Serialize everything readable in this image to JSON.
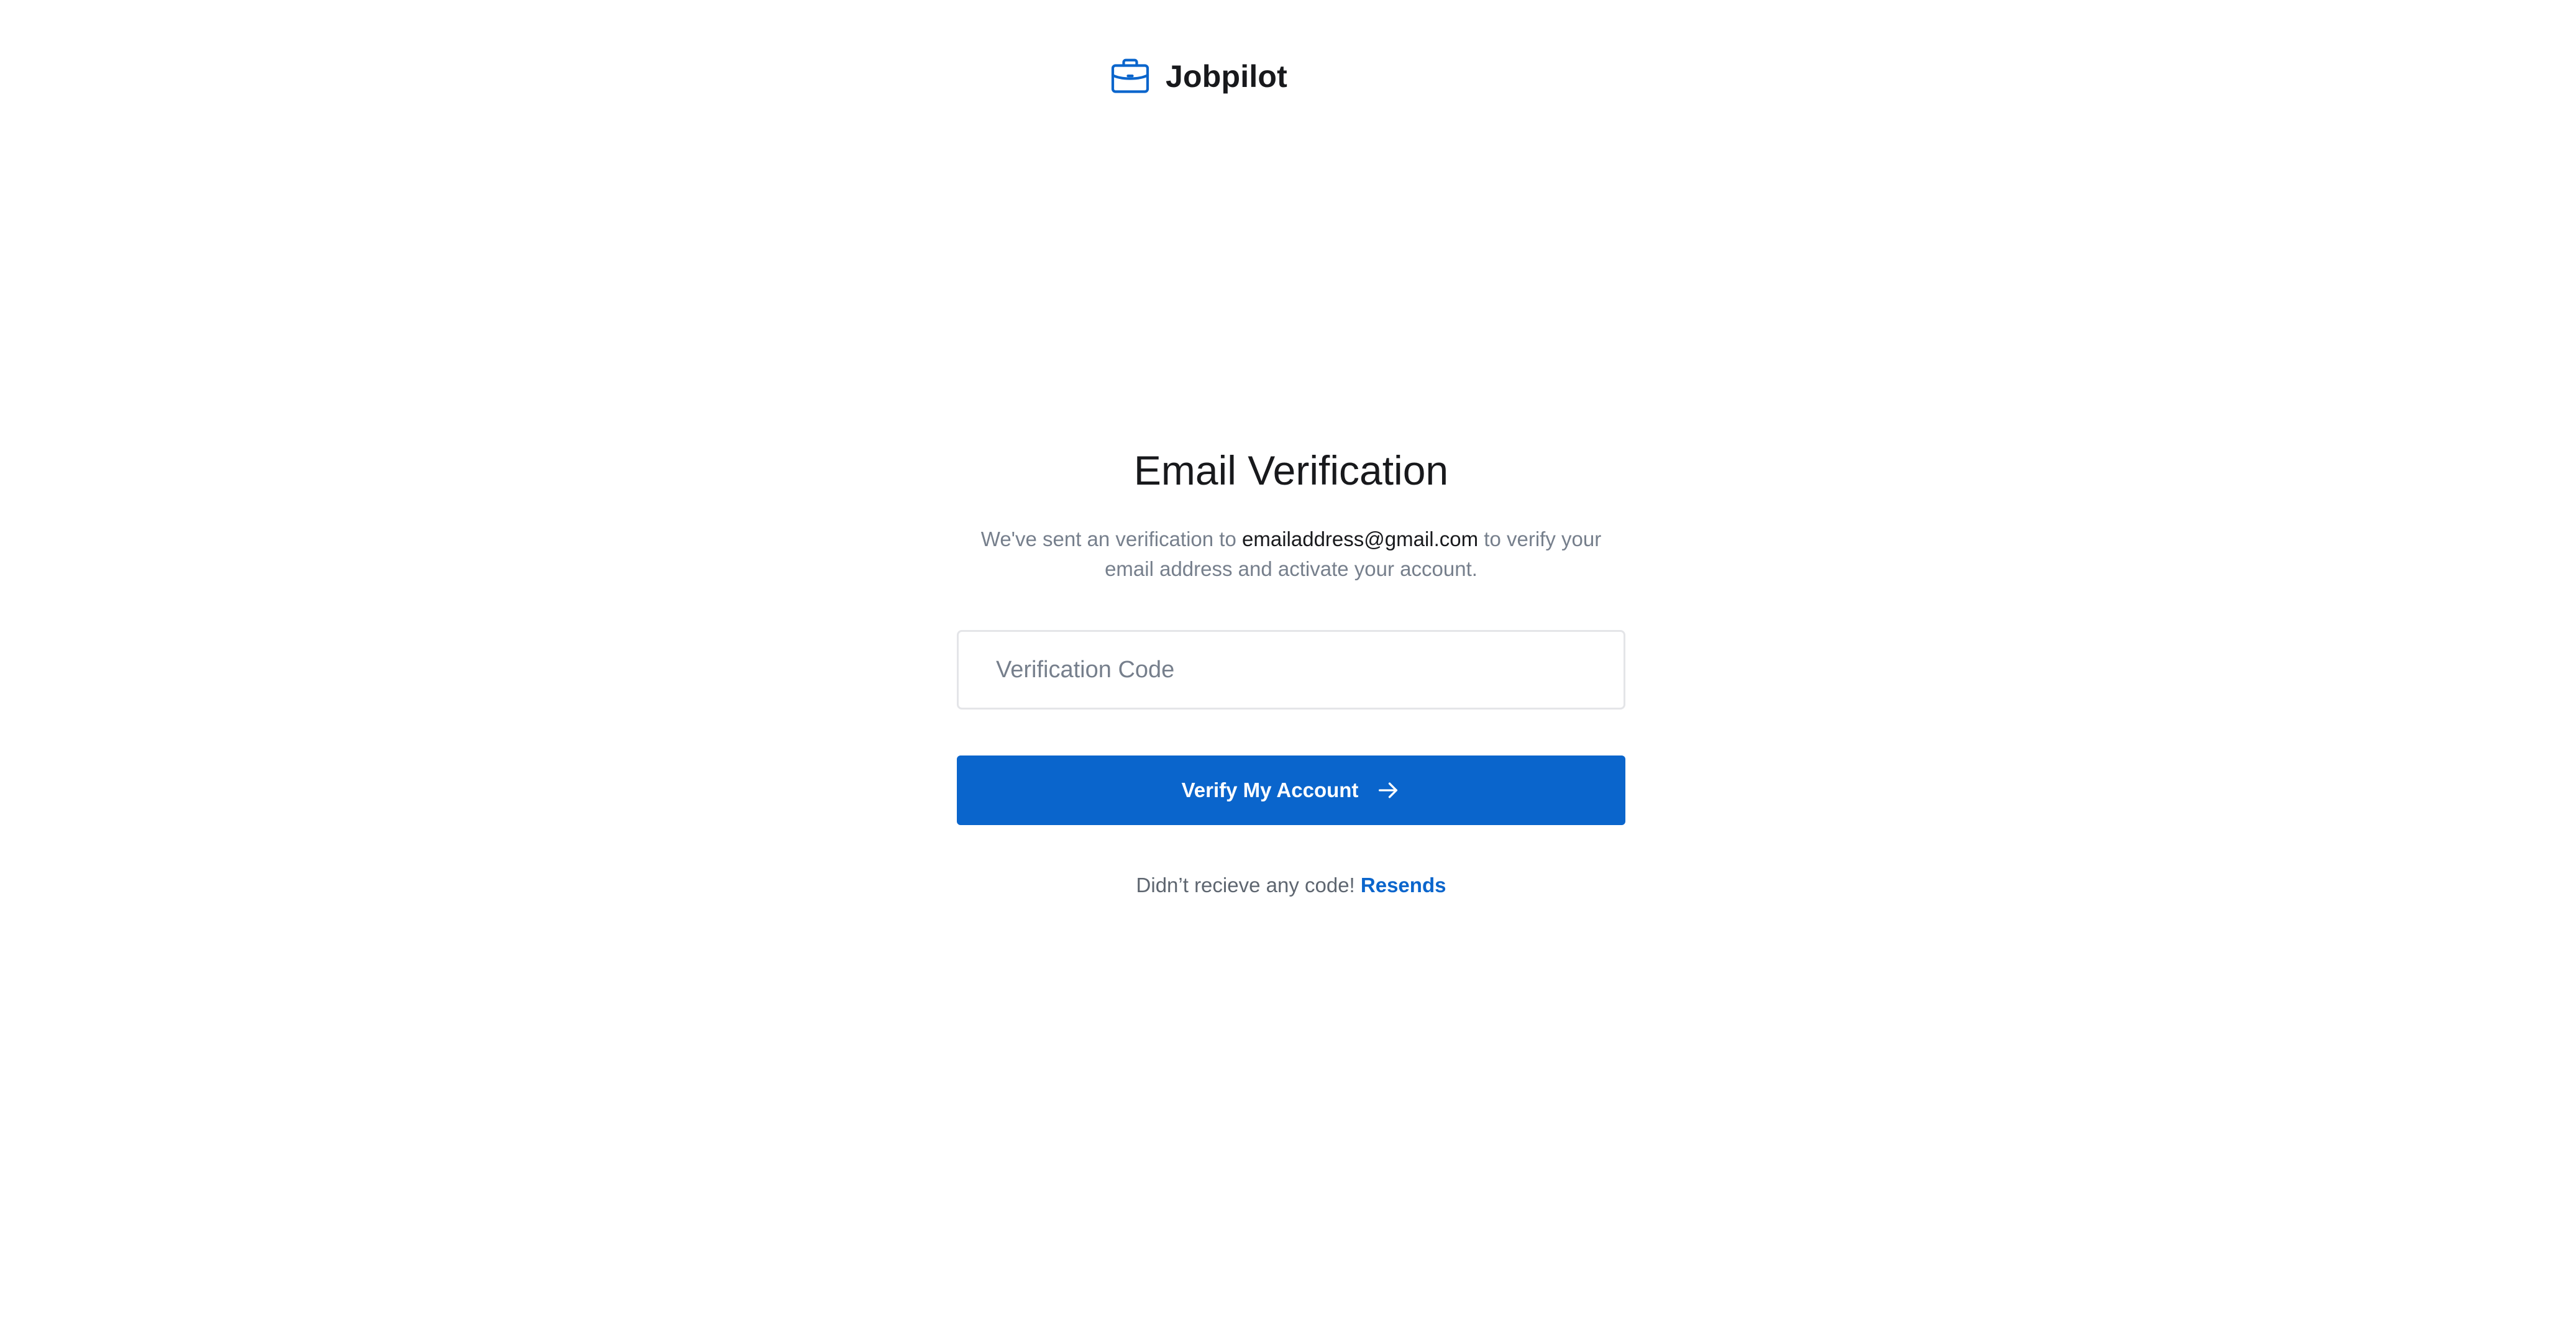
{
  "brand": {
    "name": "Jobpilot",
    "icon": "briefcase-icon",
    "accent_color": "#0a65cc"
  },
  "verification": {
    "title": "Email Verification",
    "message_before": "We've sent an verification to ",
    "email": "emailaddress@gmail.com",
    "message_after": " to verify your email address and activate your account.",
    "code_placeholder": "Verification Code",
    "code_value": "",
    "verify_label": "Verify My Account",
    "verify_icon": "arrow-right-icon",
    "resend_prompt": "Didn’t recieve any code! ",
    "resend_label": "Resends"
  },
  "colors": {
    "primary": "#0a65cc",
    "text_dark": "#18191c",
    "text_muted": "#767f8c",
    "border": "#e4e5e8"
  }
}
